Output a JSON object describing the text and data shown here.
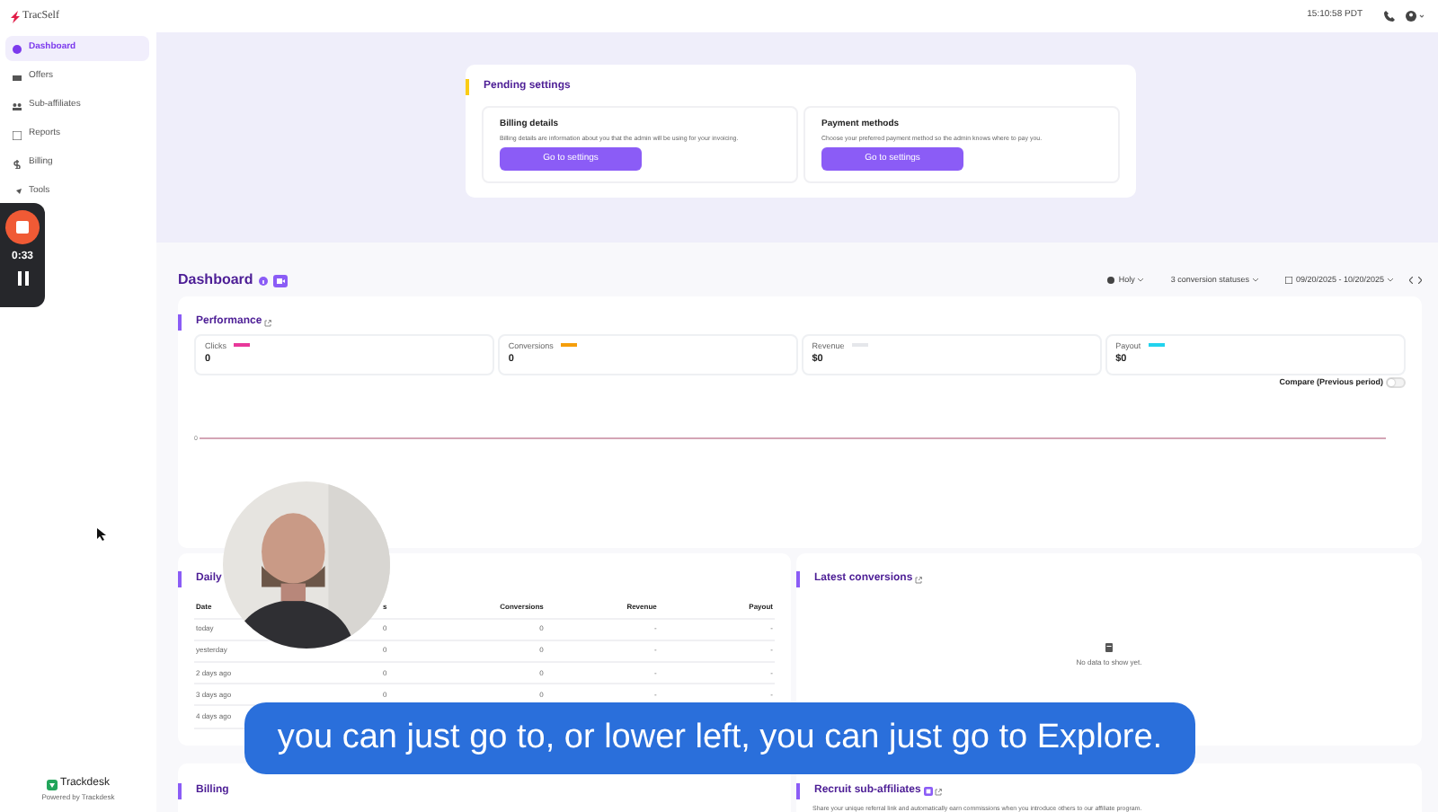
{
  "top_bar": {
    "logo": "TracSelf",
    "time": "15:10:58 PDT"
  },
  "sidebar": {
    "items": [
      {
        "label": "Dashboard",
        "selected": true
      },
      {
        "label": "Offers",
        "selected": false
      },
      {
        "label": "Sub-affiliates",
        "selected": false
      },
      {
        "label": "Reports",
        "selected": false
      },
      {
        "label": "Billing",
        "selected": false
      },
      {
        "label": "Tools",
        "selected": false
      }
    ],
    "footer_logo": "Trackdesk",
    "footer_note": "Powered by Trackdesk"
  },
  "pending": {
    "title": "Pending settings",
    "cards": [
      {
        "title": "Billing details",
        "description": "Billing details are information about you that the admin will be using for your invoicing.",
        "button": "Go to settings"
      },
      {
        "title": "Payment methods",
        "description": "Choose your preferred payment method so the admin knows where to pay you.",
        "button": "Go to settings"
      }
    ]
  },
  "dashboard": {
    "title": "Dashboard",
    "filters": [
      {
        "kind": "globe",
        "label": "Holy"
      },
      {
        "kind": "plain",
        "label": "3 conversion statuses"
      },
      {
        "kind": "calendar",
        "label": "09/20/2025 - 10/20/2025"
      }
    ]
  },
  "performance": {
    "title": "Performance",
    "metrics": [
      {
        "label": "Clicks",
        "value": "0",
        "color": "#e8389a"
      },
      {
        "label": "Conversions",
        "value": "0",
        "color": "#f59e0b"
      },
      {
        "label": "Revenue",
        "value": "$0",
        "color": "#e5e7eb"
      },
      {
        "label": "Payout",
        "value": "$0",
        "color": "#22d3ee"
      }
    ],
    "compare": {
      "label": "Compare (Previous period)",
      "on": false
    },
    "y_tick": "0"
  },
  "daily": {
    "title": "Daily",
    "columns": [
      "Date",
      "s",
      "Conversions",
      "Revenue",
      "Payout"
    ],
    "rows": [
      [
        "today",
        "0",
        "0",
        "-",
        "-"
      ],
      [
        "yesterday",
        "0",
        "0",
        "-",
        "-"
      ],
      [
        "2 days ago",
        "0",
        "0",
        "-",
        "-"
      ],
      [
        "3 days ago",
        "0",
        "0",
        "-",
        "-"
      ],
      [
        "4 days ago"
      ]
    ]
  },
  "latest": {
    "title": "Latest conversions",
    "empty_text": "No data to show yet."
  },
  "billing": {
    "title": "Billing"
  },
  "recruit": {
    "title": "Recruit sub-affiliates",
    "text": "Share your unique referral link and automatically earn commissions when you introduce others to our affiliate program."
  },
  "recorder": {
    "time": "0:33"
  },
  "caption": "you can just go to, or lower left, you can just go to Explore."
}
